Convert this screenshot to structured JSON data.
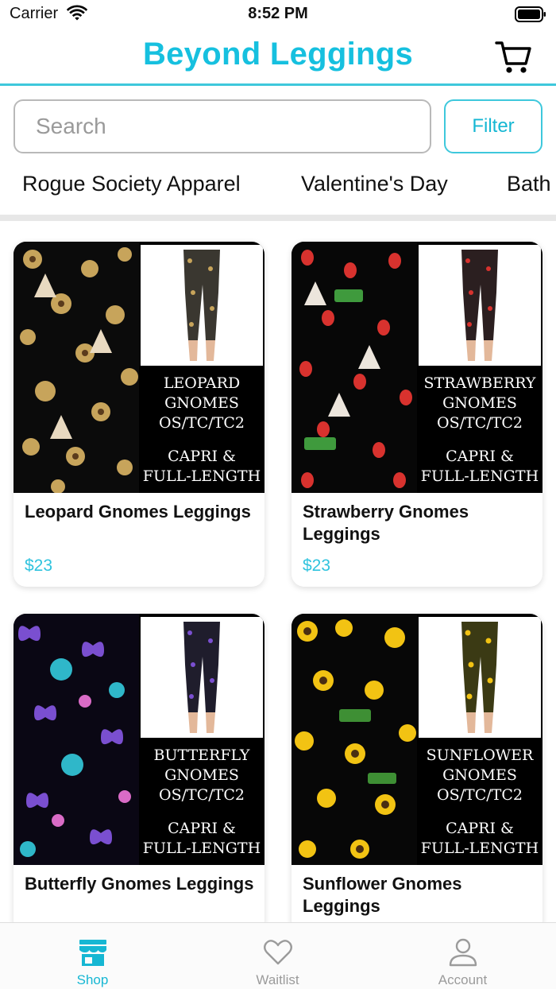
{
  "status_bar": {
    "carrier": "Carrier",
    "time": "8:52 PM"
  },
  "header": {
    "title": "Beyond Leggings",
    "cart_icon": "cart-icon"
  },
  "search": {
    "placeholder": "Search",
    "value": ""
  },
  "filter": {
    "label": "Filter"
  },
  "categories": [
    "Rogue Society Apparel",
    "Valentine's Day",
    "Bath"
  ],
  "products": [
    {
      "name": "Leopard Gnomes Leggings",
      "price": "$23",
      "pattern_text": [
        "LEOPARD",
        "GNOMES",
        "OS/TC/TC2"
      ],
      "variant_text": [
        "CAPRI &",
        "FULL-LENGTH"
      ],
      "pattern_color": "#c7a45b"
    },
    {
      "name": "Strawberry Gnomes Leggings",
      "price": "$23",
      "pattern_text": [
        "STRAWBERRY",
        "GNOMES",
        "OS/TC/TC2"
      ],
      "variant_text": [
        "CAPRI &",
        "FULL-LENGTH"
      ],
      "pattern_color": "#d8322e"
    },
    {
      "name": "Butterfly Gnomes Leggings",
      "price": "",
      "pattern_text": [
        "BUTTERFLY",
        "GNOMES",
        "OS/TC/TC2"
      ],
      "variant_text": [
        "CAPRI &",
        "FULL-LENGTH"
      ],
      "pattern_color": "#7a4fd0"
    },
    {
      "name": "Sunflower Gnomes Leggings",
      "price": "",
      "pattern_text": [
        "SUNFLOWER",
        "GNOMES",
        "OS/TC/TC2"
      ],
      "variant_text": [
        "CAPRI &",
        "FULL-LENGTH"
      ],
      "pattern_color": "#f2c313"
    }
  ],
  "tabs": [
    {
      "label": "Shop",
      "icon": "shop-icon",
      "active": true
    },
    {
      "label": "Waitlist",
      "icon": "heart-icon",
      "active": false
    },
    {
      "label": "Account",
      "icon": "user-icon",
      "active": false
    }
  ],
  "colors": {
    "accent": "#16c0df",
    "border": "#b9b9b9"
  }
}
